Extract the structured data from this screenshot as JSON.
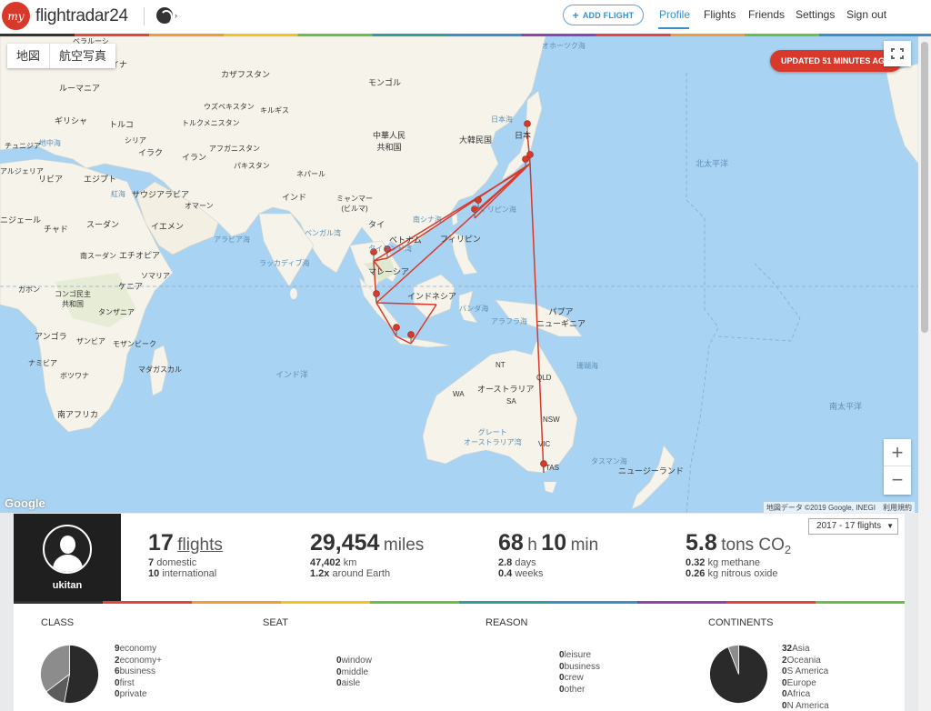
{
  "brand": {
    "prefix": "my",
    "name": "flightradar24"
  },
  "header": {
    "add_flight": "ADD FLIGHT",
    "nav": [
      "Profile",
      "Flights",
      "Friends",
      "Settings",
      "Sign out"
    ]
  },
  "map": {
    "type_tabs": [
      "地図",
      "航空写真"
    ],
    "updated": "UPDATED 51 MINUTES AGO",
    "attribution": "地図データ ©2019 Google, INEGI　利用規約",
    "google": "Google",
    "labels": {
      "mongolia": "モンゴル",
      "kazakhstan": "カザフスタン",
      "china": "中華人民\n共和国",
      "india": "インド",
      "japan": "日本",
      "korea": "大韓民国",
      "philippines": "フィリピン",
      "vietnam": "ベトナム",
      "malaysia": "マレーシア",
      "indonesia": "インドネシア",
      "australia": "オーストラリア",
      "png": "パプア\nニューギニア",
      "nz": "ニュージーランド",
      "thailand": "タイ",
      "north_pacific": "北太平洋",
      "south_pacific": "南太平洋",
      "indian_ocean": "インド洋",
      "arabian_sea": "アラビア海",
      "bengal": "ベンガル湾",
      "egypt": "エジプト",
      "libya": "リビア",
      "saudi": "サウジアラビア",
      "iran": "イラン",
      "turkey": "トルコ",
      "afghanistan": "アフガニスタン",
      "pakistan": "パキスタン",
      "sudan": "スーダン",
      "chad": "チャド",
      "niger": "ニジェール",
      "ethiopia": "エチオピア",
      "kenya": "ケニア",
      "somalia": "ソマリア",
      "tanzania": "タンザニア",
      "angola": "アンゴラ",
      "zambia": "ザンビア",
      "mozambique": "モザンビーク",
      "namibia": "ナミビア",
      "botswana": "ボツワナ",
      "south_africa": "南アフリカ",
      "madagascar": "マダガスカル",
      "congo": "コンゴ民主\n共和国",
      "yemen": "イエメン",
      "oman": "オマーン",
      "iraq": "イラク",
      "syria": "シリア",
      "uzbekistan": "ウズベキスタン",
      "turkmenistan": "トルクメニスタン",
      "kyrgyz": "キルギス",
      "nepal": "ネパール",
      "myanmar": "ミャンマー\n(ビルマ)",
      "romania": "ルーマニア",
      "ukraine": "ウクライナ",
      "greece": "ギリシャ",
      "tunisia": "チュニジア",
      "algeria": "アルジェリア",
      "belarus": "ベラルーシ",
      "south_sudan": "南スーダン",
      "okhotsk": "オホーツク海",
      "philippine_sea": "フィリピン海",
      "banda_sea": "バンダ海",
      "arafura": "アラフラ海",
      "tasman": "タスマン海",
      "coral": "珊瑚海",
      "bight": "グレート\nオーストラリア湾",
      "laccadive": "ラッカディブ海",
      "thai_gulf": "タイランド湾",
      "south_china": "南シナ海",
      "red_sea": "紅海",
      "med": "地中海",
      "japan_sea": "日本海",
      "gabon": "ガボン",
      "wa": "WA",
      "nt": "NT",
      "qld": "QLD",
      "sa": "SA",
      "nsw": "NSW",
      "vic": "VIC",
      "tas": "TAS"
    }
  },
  "profile": {
    "username": "ukitan",
    "year_select": "2017 - 17 flights"
  },
  "stats": {
    "flights": {
      "value": "17",
      "unit": "flights",
      "domestic": "7",
      "domestic_label": "domestic",
      "international": "10",
      "international_label": "international"
    },
    "distance": {
      "value": "29,454",
      "unit": "miles",
      "km": "47,402",
      "km_label": "km",
      "earth": "1.2x",
      "earth_label": "around Earth"
    },
    "time": {
      "hours": "68",
      "h": "h",
      "minutes": "10",
      "min": "min",
      "days": "2.8",
      "days_label": "days",
      "weeks": "0.4",
      "weeks_label": "weeks"
    },
    "co2": {
      "value": "5.8",
      "unit": "tons CO",
      "sub2": "2",
      "methane": "0.32",
      "methane_label": "kg methane",
      "nitrous": "0.26",
      "nitrous_label": "kg nitrous oxide"
    }
  },
  "categories": {
    "class": {
      "title": "CLASS",
      "items": [
        [
          "9",
          "economy"
        ],
        [
          "2",
          "economy+"
        ],
        [
          "6",
          "business"
        ],
        [
          "0",
          "first"
        ],
        [
          "0",
          "private"
        ]
      ]
    },
    "seat": {
      "title": "SEAT",
      "items": [
        [
          "0",
          "window"
        ],
        [
          "0",
          "middle"
        ],
        [
          "0",
          "aisle"
        ]
      ]
    },
    "reason": {
      "title": "REASON",
      "items": [
        [
          "0",
          "leisure"
        ],
        [
          "0",
          "business"
        ],
        [
          "0",
          "crew"
        ],
        [
          "0",
          "other"
        ]
      ]
    },
    "continents": {
      "title": "CONTINENTS",
      "items": [
        [
          "32",
          "Asia"
        ],
        [
          "2",
          "Oceania"
        ],
        [
          "0",
          "S America"
        ],
        [
          "0",
          "Europe"
        ],
        [
          "0",
          "Africa"
        ],
        [
          "0",
          "N America"
        ]
      ]
    }
  },
  "colors": {
    "accent": "#3a8fc8",
    "brand": "#d9392a",
    "route": "#d9392a",
    "land": "#f5f3ea",
    "sea": "#a9d3f2"
  }
}
